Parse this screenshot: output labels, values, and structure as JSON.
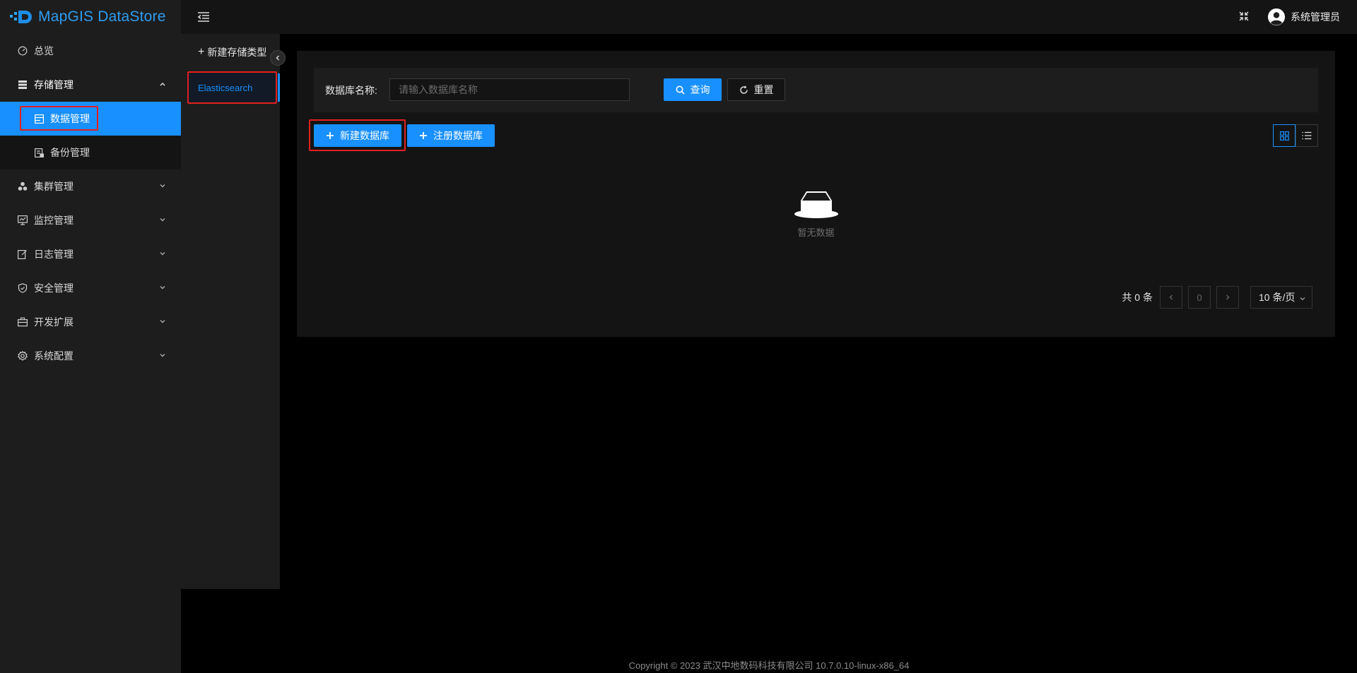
{
  "app": {
    "title": "MapGIS DataStore",
    "brand_color": "#1890ff"
  },
  "sidebar": {
    "overview": "总览",
    "storage": "存储管理",
    "storage_children": [
      "数据管理",
      "备份管理"
    ],
    "items": [
      "集群管理",
      "监控管理",
      "日志管理",
      "安全管理",
      "开发扩展",
      "系统配置"
    ]
  },
  "topbar": {
    "user": "系统管理员"
  },
  "type_panel": {
    "new_type": "新建存储类型",
    "types": [
      "Elasticsearch"
    ]
  },
  "search": {
    "label": "数据库名称:",
    "placeholder": "请输入数据库名称",
    "query_button": "查询",
    "reset_button": "重置"
  },
  "actions": {
    "new_db": "新建数据库",
    "register_db": "注册数据库"
  },
  "empty": {
    "text": "暂无数据"
  },
  "pagination": {
    "total": "共 0 条",
    "page": "0",
    "page_size": "10 条/页"
  },
  "footer": {
    "copyright": "Copyright © 2023 武汉中地数码科技有限公司 10.7.0.10-linux-x86_64"
  }
}
